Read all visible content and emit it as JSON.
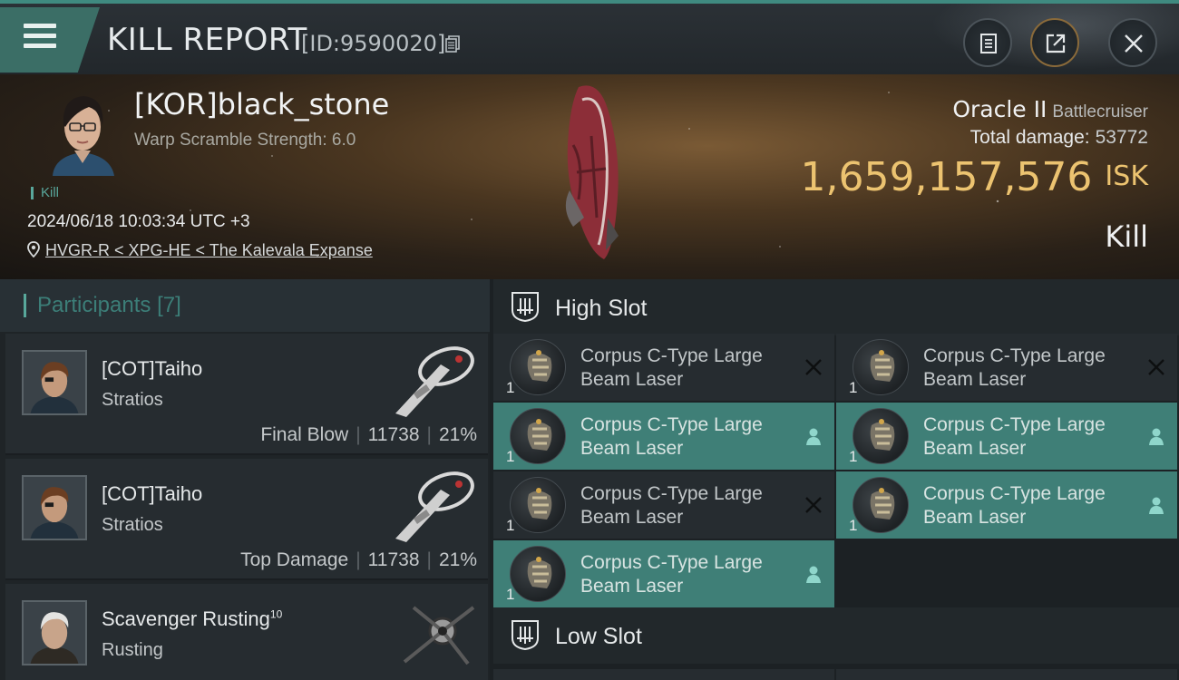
{
  "header": {
    "title": "KILL REPORT",
    "report_id": "[ID:9590020]"
  },
  "victim": {
    "pilot_name": "[KOR]black_stone",
    "warp_scramble": "Warp Scramble Strength: 6.0",
    "tag": "Kill",
    "datetime": "2024/06/18 10:03:34 UTC +3",
    "location": "HVGR-R < XPG-HE < The Kalevala Expanse",
    "ship_name": "Oracle II",
    "ship_class": "Battlecruiser",
    "total_damage_label": "Total damage:",
    "total_damage": "53772",
    "isk_value": "1,659,157,576",
    "isk_unit": "ISK",
    "kill_type": "Kill"
  },
  "participants": {
    "label": "Participants",
    "count": "[7]",
    "items": [
      {
        "name": "[COT]Taiho",
        "sup": "",
        "ship": "Stratios",
        "role": "Final Blow",
        "damage": "11738",
        "percent": "21%"
      },
      {
        "name": "[COT]Taiho",
        "sup": "",
        "ship": "Stratios",
        "role": "Top Damage",
        "damage": "11738",
        "percent": "21%"
      },
      {
        "name": "Scavenger Rusting",
        "sup": "10",
        "ship": "Rusting",
        "role": "",
        "damage": "",
        "percent": ""
      }
    ]
  },
  "slots": {
    "high": {
      "label": "High Slot",
      "modules": [
        {
          "line1": "Corpus C-Type Large",
          "line2": "Beam Laser",
          "qty": "1",
          "state": "destroyed"
        },
        {
          "line1": "Corpus C-Type Large",
          "line2": "Beam Laser",
          "qty": "1",
          "state": "destroyed"
        },
        {
          "line1": "Corpus C-Type Large",
          "line2": "Beam Laser",
          "qty": "1",
          "state": "dropped"
        },
        {
          "line1": "Corpus C-Type Large",
          "line2": "Beam Laser",
          "qty": "1",
          "state": "dropped"
        },
        {
          "line1": "Corpus C-Type Large",
          "line2": "Beam Laser",
          "qty": "1",
          "state": "destroyed"
        },
        {
          "line1": "Corpus C-Type Large",
          "line2": "Beam Laser",
          "qty": "1",
          "state": "dropped"
        },
        {
          "line1": "Corpus C-Type Large",
          "line2": "Beam Laser",
          "qty": "1",
          "state": "dropped"
        }
      ]
    },
    "low": {
      "label": "Low Slot"
    }
  },
  "icons": {
    "menu": "hamburger-menu-icon",
    "copy": "copy-icon",
    "clipboard": "clipboard-icon",
    "share": "share-icon",
    "close": "close-icon",
    "location": "location-pin-icon",
    "destroyed": "x-mark-icon",
    "dropped": "person-icon"
  },
  "colors": {
    "accent_teal": "#3f7f77",
    "isk_gold": "#ecc370"
  }
}
